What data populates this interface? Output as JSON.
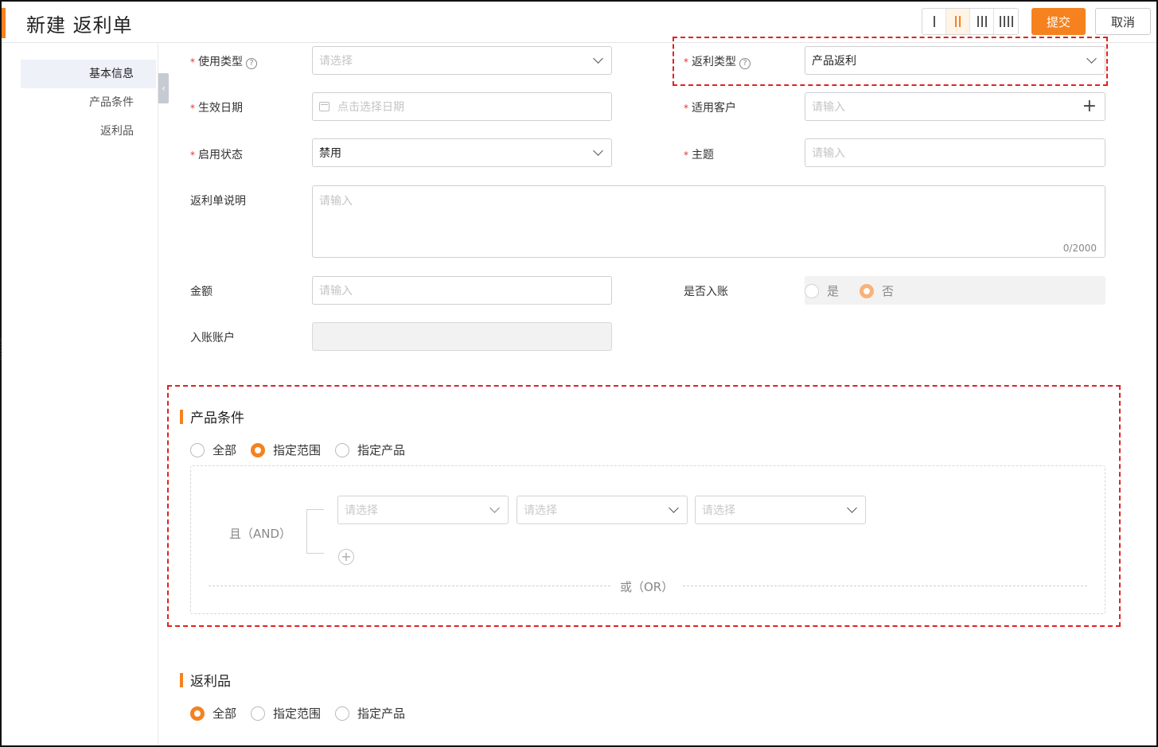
{
  "header": {
    "title": "新建 返利单",
    "submit_label": "提交",
    "cancel_label": "取消",
    "column_options": [
      "1-column",
      "2-column",
      "3-column",
      "4-column"
    ],
    "selected_columns": "2-column"
  },
  "sidebar": {
    "items": [
      {
        "label": "基本信息",
        "active": true
      },
      {
        "label": "产品条件",
        "active": false
      },
      {
        "label": "返利品",
        "active": false
      }
    ]
  },
  "form": {
    "usage_type": {
      "label": "使用类型",
      "placeholder": "请选择"
    },
    "rebate_type": {
      "label": "返利类型",
      "value": "产品返利"
    },
    "effective_date": {
      "label": "生效日期",
      "placeholder": "点击选择日期"
    },
    "applicable_customer": {
      "label": "适用客户",
      "placeholder": "请输入"
    },
    "status": {
      "label": "启用状态",
      "value": "禁用"
    },
    "subject": {
      "label": "主题",
      "placeholder": "请输入"
    },
    "description": {
      "label": "返利单说明",
      "placeholder": "请输入",
      "counter": "0/2000"
    },
    "amount": {
      "label": "金额",
      "placeholder": "请输入"
    },
    "is_posted": {
      "label": "是否入账",
      "options": [
        "是",
        "否"
      ],
      "selected": "否"
    },
    "account": {
      "label": "入账账户"
    }
  },
  "product_conditions": {
    "title": "产品条件",
    "options": [
      "全部",
      "指定范围",
      "指定产品"
    ],
    "selected": "指定范围",
    "and_label": "且（AND）",
    "or_label": "或（OR）",
    "selects": [
      {
        "placeholder": "请选择"
      },
      {
        "placeholder": "请选择"
      },
      {
        "placeholder": "请选择"
      }
    ]
  },
  "rebate_goods": {
    "title": "返利品",
    "options": [
      "全部",
      "指定范围",
      "指定产品"
    ],
    "selected": "全部"
  },
  "colors": {
    "accent": "#f5821f",
    "required": "#e02222",
    "highlight": "#e02222"
  }
}
